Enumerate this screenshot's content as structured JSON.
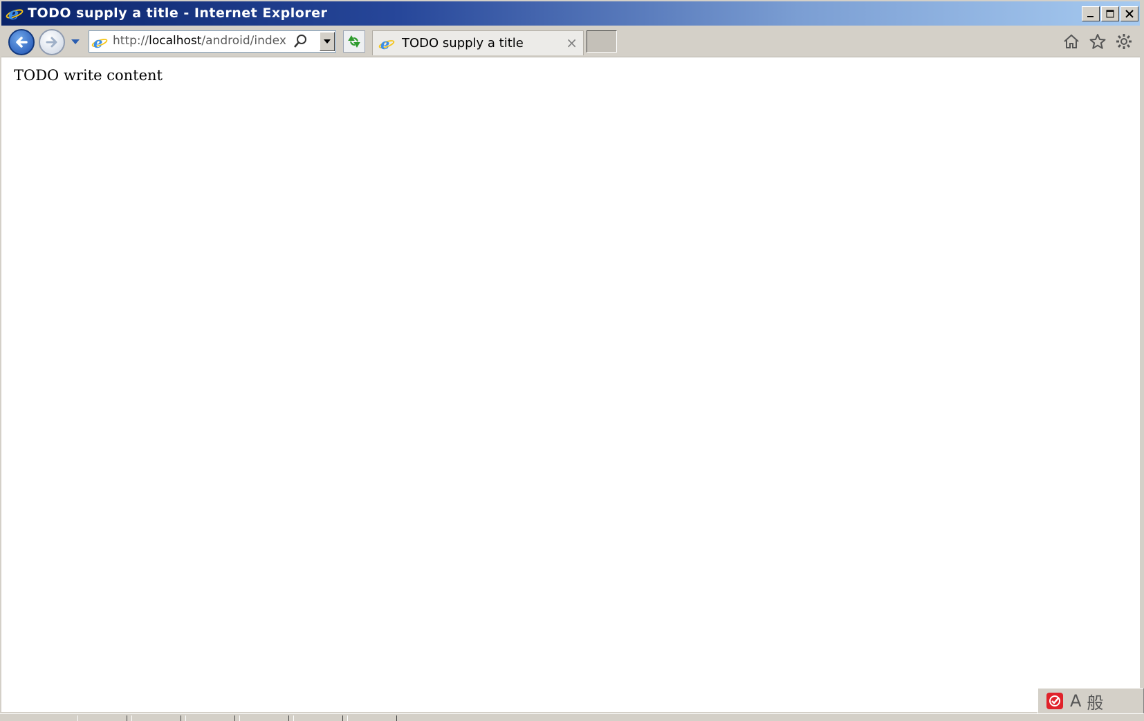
{
  "window": {
    "title": "TODO supply a title - Internet Explorer"
  },
  "navbar": {
    "url_prefix": "http://",
    "url_host": "localhost",
    "url_path": "/android/index.htı",
    "tab_title": "TODO supply a title",
    "tab_close": "×"
  },
  "page": {
    "content_text": "TODO write content"
  },
  "ime": {
    "mode_a": "A",
    "mode_kanji": "般"
  },
  "colors": {
    "titlebar_start": "#0a246a",
    "titlebar_end": "#a6caf0",
    "chrome": "#d4d0c8",
    "back_button": "#1d4fb0"
  },
  "icons": [
    "ie-logo-icon",
    "minimize-icon",
    "maximize-icon",
    "close-icon",
    "back-arrow-icon",
    "forward-arrow-icon",
    "search-icon",
    "refresh-icon",
    "home-icon",
    "favorites-star-icon",
    "gear-icon",
    "ime-icon"
  ]
}
